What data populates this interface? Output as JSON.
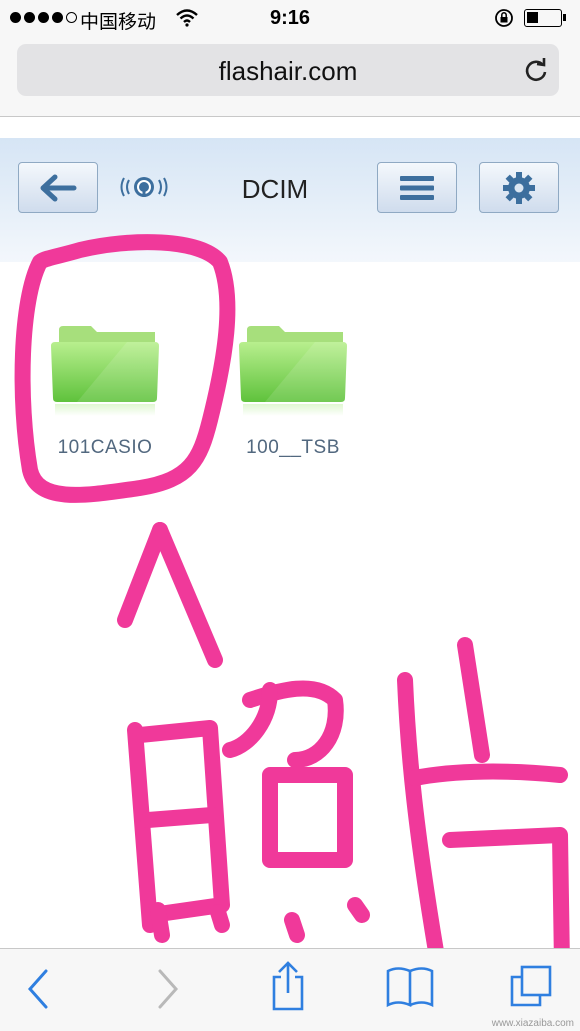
{
  "status_bar": {
    "carrier": "中国移动",
    "time": "9:16"
  },
  "browser": {
    "url": "flashair.com"
  },
  "app": {
    "title": "DCIM"
  },
  "folders": [
    {
      "name": "101CASIO"
    },
    {
      "name": "100__TSB"
    }
  ],
  "annotation": {
    "text": "照片",
    "color": "#f0399a"
  },
  "watermark": "www.xiazaiba.com",
  "icons": {
    "back": "back-arrow-icon",
    "logo": "flashair-logo-icon",
    "menu": "menu-icon",
    "settings": "gear-icon",
    "folder": "folder-icon"
  },
  "colors": {
    "accent": "#3d6f9e",
    "folder": "#7fd35a",
    "annotation": "#f0399a"
  }
}
